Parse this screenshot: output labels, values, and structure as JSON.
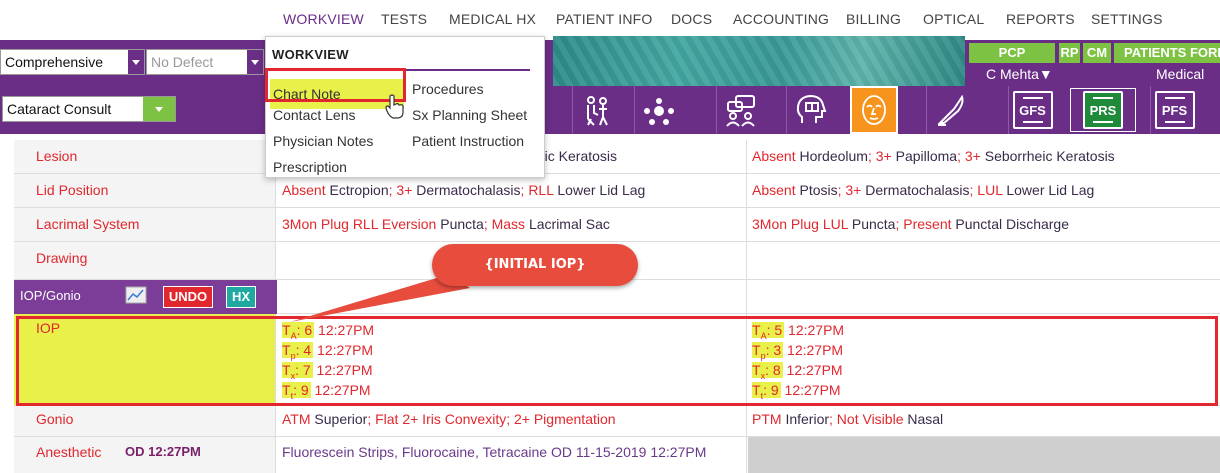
{
  "topnav": {
    "items": [
      "WORKVIEW",
      "TESTS",
      "MEDICAL HX",
      "PATIENT INFO",
      "DOCS",
      "ACCOUNTING",
      "BILLING",
      "OPTICAL",
      "REPORTS",
      "SETTINGS"
    ]
  },
  "toolbar": {
    "exam_type": "Comprehensive",
    "defect": "No Defect",
    "template": "Cataract Consult",
    "pcp": "PCP",
    "rp": "RP",
    "cm": "CM",
    "patients_forms": "PATIENTS FORI",
    "provider": "C Mehta",
    "medical": "Medical",
    "tools": [
      "GFS",
      "PRS",
      "PFS"
    ]
  },
  "menu": {
    "header": "WORKVIEW",
    "col1": [
      "Chart Note",
      "Contact Lens",
      "Physician Notes",
      "Prescription"
    ],
    "col2": [
      "Procedures",
      "Sx Planning Sheet",
      "Patient Instruction"
    ]
  },
  "callout": "{INITIAL IOP}",
  "rows": {
    "lesion": {
      "label": "Lesion",
      "od_tail": "orrheic Keratosis",
      "os": [
        [
          "Absent ",
          "r"
        ],
        [
          "Hordeolum",
          "k"
        ],
        [
          "; 3+ ",
          "r"
        ],
        [
          "Papilloma",
          "k"
        ],
        [
          "; 3+ ",
          "r"
        ],
        [
          "Seborrheic Keratosis",
          "k"
        ]
      ]
    },
    "lid": {
      "label": "Lid Position",
      "od": [
        [
          "Absent ",
          "r"
        ],
        [
          "Ectropion",
          "k"
        ],
        [
          "; 3+ ",
          "r"
        ],
        [
          "Dermatochalasis",
          "k"
        ],
        [
          "; RLL ",
          "r"
        ],
        [
          "Lower Lid Lag",
          "k"
        ]
      ],
      "os": [
        [
          "Absent ",
          "r"
        ],
        [
          "Ptosis",
          "k"
        ],
        [
          "; 3+ ",
          "r"
        ],
        [
          "Dermatochalasis",
          "k"
        ],
        [
          "; LUL ",
          "r"
        ],
        [
          "Lower Lid Lag",
          "k"
        ]
      ]
    },
    "lacrimal": {
      "label": "Lacrimal System",
      "od": [
        [
          "3Mon Plug RLL Eversion ",
          "r"
        ],
        [
          "Puncta",
          "k"
        ],
        [
          "; Mass ",
          "r"
        ],
        [
          "Lacrimal Sac",
          "k"
        ]
      ],
      "os": [
        [
          "3Mon Plug LUL ",
          "r"
        ],
        [
          "Puncta",
          "k"
        ],
        [
          "; Present ",
          "r"
        ],
        [
          "Punctal Discharge",
          "k"
        ]
      ]
    },
    "drawing": {
      "label": "Drawing"
    },
    "iop_gonio": {
      "label": "IOP/Gonio",
      "undo": "UNDO",
      "hx": "HX"
    },
    "iop": {
      "label": "IOP",
      "od": [
        {
          "sub": "A",
          "val": "6",
          "time": "12:27PM"
        },
        {
          "sub": "p",
          "val": "4",
          "time": "12:27PM"
        },
        {
          "sub": "x",
          "val": "7",
          "time": "12:27PM"
        },
        {
          "sub": "t",
          "val": "9",
          "time": "12:27PM"
        }
      ],
      "os": [
        {
          "sub": "A",
          "val": "5",
          "time": "12:27PM"
        },
        {
          "sub": "p",
          "val": "3",
          "time": "12:27PM"
        },
        {
          "sub": "x",
          "val": "8",
          "time": "12:27PM"
        },
        {
          "sub": "t",
          "val": "9",
          "time": "12:27PM"
        }
      ]
    },
    "gonio": {
      "label": "Gonio",
      "od": [
        [
          "ATM ",
          "r"
        ],
        [
          "Superior",
          "k"
        ],
        [
          "; Flat 2+ Iris Convexity; 2+ Pigmentation",
          "r"
        ]
      ],
      "os": [
        [
          "PTM ",
          "r"
        ],
        [
          "Inferior",
          "k"
        ],
        [
          "; Not Visible ",
          "r"
        ],
        [
          "Nasal",
          "k"
        ]
      ]
    },
    "anesthetic": {
      "label": "Anesthetic",
      "time": "OD 12:27PM",
      "od": "Fluorescein Strips, Fluorocaine, Tetracaine OD 11-15-2019 12:27PM"
    }
  },
  "colors": {
    "purple": "#6a2e86",
    "green": "#7dc242",
    "red": "#e0282e",
    "highlight": "#e9f04a",
    "orange": "#f7941d"
  }
}
